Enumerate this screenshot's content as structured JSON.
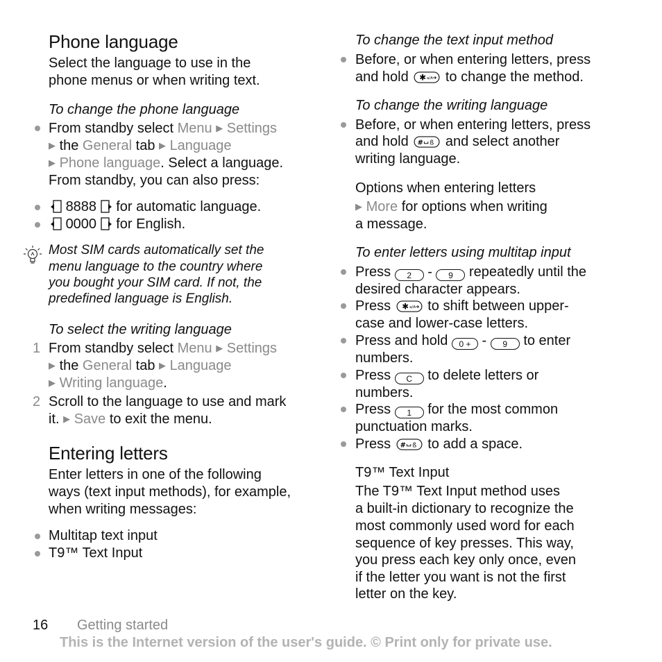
{
  "left": {
    "phone_language": {
      "title": "Phone language",
      "intro": [
        "Select the language to use in the",
        "phone menus or when writing text."
      ],
      "subheading": "To change the phone language",
      "step_lines": {
        "l1_a": "From standby select ",
        "l1_menu": "Menu",
        "l1_settings": "Settings",
        "l2_the": "the ",
        "l2_general": "General",
        "l2_tab": " tab ",
        "l2_language": "Language",
        "l3_phone": "Phone language",
        "l3_rest": ". Select a language.",
        "l4": "From standby, you can also press:"
      },
      "shortcuts": [
        {
          "code": "8888",
          "text": "for automatic language."
        },
        {
          "code": "0000",
          "text": "for English."
        }
      ],
      "tip": [
        "Most SIM cards automatically set the",
        "menu language to the country where",
        "you bought your SIM card. If not, the",
        "predefined language is English."
      ]
    },
    "writing_language": {
      "subheading": "To select the writing language",
      "step1": {
        "num": "1",
        "l1_a": "From standby select ",
        "l1_menu": "Menu",
        "l1_settings": "Settings",
        "l2_the": "the ",
        "l2_general": "General",
        "l2_tab": " tab ",
        "l2_language": "Language",
        "l3_writing": "Writing language",
        "l3_rest": "."
      },
      "step2": {
        "num": "2",
        "l1": "Scroll to the language to use and mark",
        "l2_a": "it. ",
        "l2_save": "Save",
        "l2_rest": " to exit the menu."
      }
    },
    "entering_letters": {
      "title": "Entering letters",
      "intro": [
        "Enter letters in one of the following",
        "ways (text input methods), for example,",
        "when writing messages:"
      ],
      "methods": [
        "Multitap text input",
        "T9™ Text Input"
      ]
    }
  },
  "right": {
    "input_method": {
      "subheading": "To change the text input method",
      "l1": "Before, or when entering letters, press",
      "l2_a": "and hold ",
      "l2_b": " to change the method."
    },
    "writing_language": {
      "subheading": "To change the writing language",
      "l1": "Before, or when entering letters, press",
      "l2_a": "and hold ",
      "l2_b": " and select another",
      "l3": "writing language."
    },
    "options": {
      "heading": "Options when entering letters",
      "l1_more": "More",
      "l1_rest": " for options when writing",
      "l2": "a message."
    },
    "multitap": {
      "subheading": "To enter letters using multitap input",
      "items": [
        {
          "l1_a": "Press ",
          "key1": "2",
          "dash": " - ",
          "key2": "9",
          "l1_b": " repeatedly until the",
          "l2": "desired character appears."
        },
        {
          "l1_a": "Press ",
          "l1_b": " to shift between upper-",
          "l2": "case and lower-case letters."
        },
        {
          "l1_a": "Press and hold ",
          "key1": "0 +",
          "dash": " - ",
          "key2": "9",
          "l1_b": " to enter",
          "l2": "numbers."
        },
        {
          "l1_a": "Press ",
          "key1": "C",
          "l1_b": " to delete letters or",
          "l2": "numbers."
        },
        {
          "l1_a": "Press ",
          "key1": "1",
          "l1_b": " for the most common",
          "l2": "punctuation marks."
        },
        {
          "l1_a": "Press ",
          "l1_b": " to add a space."
        }
      ]
    },
    "t9": {
      "heading": "T9™ Text Input",
      "body": [
        "The T9™ Text Input method uses",
        "a built-in dictionary to recognize the",
        "most commonly used word for each",
        "sequence of key presses. This way,",
        "you press each key only once, even",
        "if the letter you want is not the first",
        "letter on the key."
      ]
    }
  },
  "footer": {
    "page_number": "16",
    "section": "Getting started",
    "copyright": "This is the Internet version of the user's guide. © Print only for private use."
  },
  "icons": {
    "arrow": "▶",
    "star_key": "star-shift-key-icon",
    "hash_key": "hash-space-key-icon",
    "left_softkey": "left-selection-key-icon",
    "right_softkey": "right-selection-key-icon",
    "tip": "lightbulb-icon"
  }
}
